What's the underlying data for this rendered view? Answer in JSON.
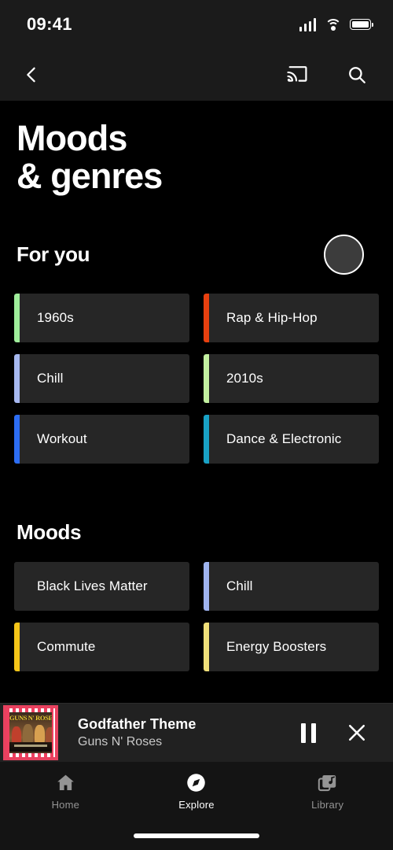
{
  "status_bar": {
    "time": "09:41",
    "signal_icon": "cellular-signal-icon",
    "wifi_icon": "wifi-icon",
    "battery_icon": "battery-full-icon"
  },
  "nav_bar": {
    "back_icon": "back-chevron-icon",
    "cast_icon": "cast-icon",
    "search_icon": "search-icon"
  },
  "page": {
    "title_line1": "Moods",
    "title_line2": "& genres"
  },
  "for_you": {
    "heading": "For you",
    "avatar_icon": "account-avatar-icon",
    "items": [
      {
        "label": "1960s",
        "color": "#9FEE9B"
      },
      {
        "label": "Rap & Hip-Hop",
        "color": "#E8400F"
      },
      {
        "label": "Chill",
        "color": "#A6B8F0"
      },
      {
        "label": "2010s",
        "color": "#C2F0A0"
      },
      {
        "label": "Workout",
        "color": "#2C6DF4"
      },
      {
        "label": "Dance & Electronic",
        "color": "#19A2C6"
      }
    ]
  },
  "moods": {
    "heading": "Moods",
    "items": [
      {
        "label": "Black Lives Matter",
        "color": "#262626"
      },
      {
        "label": "Chill",
        "color": "#9FB4F0"
      },
      {
        "label": "Commute",
        "color": "#F5C518"
      },
      {
        "label": "Energy Boosters",
        "color": "#F0E07A"
      }
    ]
  },
  "mini_player": {
    "album_art_text": "GUNS N' ROSES",
    "album_art_icon": "album-artwork",
    "track_title": "Godfather Theme",
    "track_artist": "Guns N' Roses",
    "pause_icon": "pause-icon",
    "close_icon": "close-icon"
  },
  "bottom_nav": {
    "tabs": [
      {
        "label": "Home",
        "icon": "home-icon",
        "active": false
      },
      {
        "label": "Explore",
        "icon": "compass-icon",
        "active": true
      },
      {
        "label": "Library",
        "icon": "library-icon",
        "active": false
      }
    ]
  },
  "colors": {
    "background": "#000000",
    "chrome": "#1b1b1b",
    "chip_bg": "#262626",
    "player_bg": "#212121",
    "nav_bg": "#141414",
    "text_primary": "#ffffff",
    "text_muted": "#949494"
  }
}
